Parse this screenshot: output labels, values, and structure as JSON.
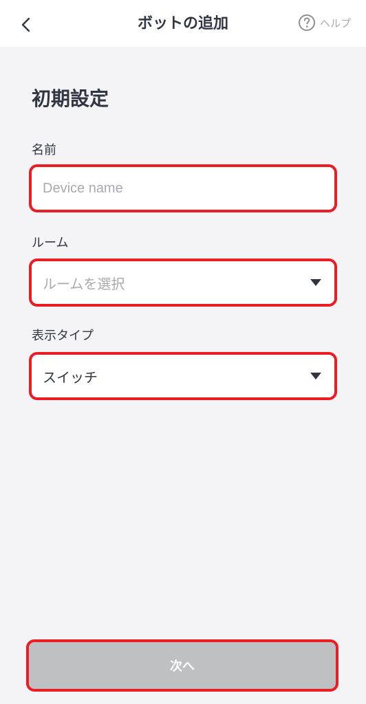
{
  "header": {
    "title": "ボットの追加",
    "help_label": "ヘルプ",
    "back_icon": "chevron-left-icon",
    "help_icon": "question-circle-icon"
  },
  "section": {
    "title": "初期設定"
  },
  "fields": {
    "name": {
      "label": "名前",
      "placeholder": "Device name",
      "value": ""
    },
    "room": {
      "label": "ルーム",
      "placeholder": "ルームを選択",
      "selected": ""
    },
    "display_type": {
      "label": "表示タイプ",
      "selected": "スイッチ"
    }
  },
  "buttons": {
    "next_label": "次へ"
  },
  "colors": {
    "highlight": "#ea1c24",
    "background": "#f4f4f7",
    "disabled_button": "#bfc0c4"
  }
}
